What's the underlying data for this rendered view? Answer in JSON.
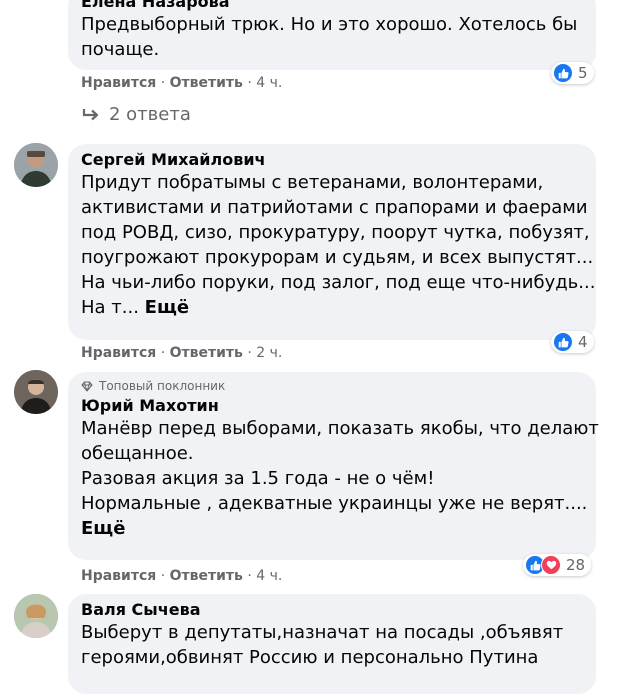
{
  "colors": {
    "bubble_bg": "#f0f2f5",
    "muted": "#65676b",
    "like_blue": "#1877f2",
    "love_red": "#f33e58"
  },
  "comments": [
    {
      "author": "Елена Назарова",
      "lines": [
        "Предвыборный трюк. Но и это хорошо. Хотелось бы",
        "почаще."
      ],
      "like_label": "Нравится",
      "reply_label": "Ответить",
      "time": "4 ч.",
      "reactions": {
        "icons": [
          "like-icon"
        ],
        "count": "5"
      }
    },
    {
      "author": "Сергей Михайлович",
      "lines": [
        "Придут побратымы с ветеранами, волонтерами,",
        "активистами и патрийотами с прапорами и фаерами",
        "под РОВД, сизо, прокуратуру, поорут чутка, побузят,",
        "поугрожают прокурорам и судьям, и всех выпустят...",
        "На чьи-либо поруки, под залог, под еще что-нибудь...",
        "На т..."
      ],
      "more_label": "Ещё",
      "like_label": "Нравится",
      "reply_label": "Ответить",
      "time": "2 ч.",
      "reactions": {
        "icons": [
          "like-icon"
        ],
        "count": "4"
      }
    },
    {
      "badge": "Топовый поклонник",
      "author": "Юрий Махотин",
      "lines": [
        "Манёвр перед выборами, показать якобы, что делают",
        "обещанное.",
        "Разовая акция за 1.5 года - не о чём!",
        "Нормальные , адекватные украинцы уже не верят...."
      ],
      "more_label": "Ещё",
      "like_label": "Нравится",
      "reply_label": "Ответить",
      "time": "4 ч.",
      "reactions": {
        "icons": [
          "like-icon",
          "love-icon"
        ],
        "count": "28"
      }
    },
    {
      "author": "Валя Сычева",
      "lines": [
        "Выберут в депутаты,назначат на посады ,объявят",
        "героями,обвинят Россию и персонально Путина"
      ]
    }
  ],
  "replies_link": "2 ответа",
  "separator": "·"
}
